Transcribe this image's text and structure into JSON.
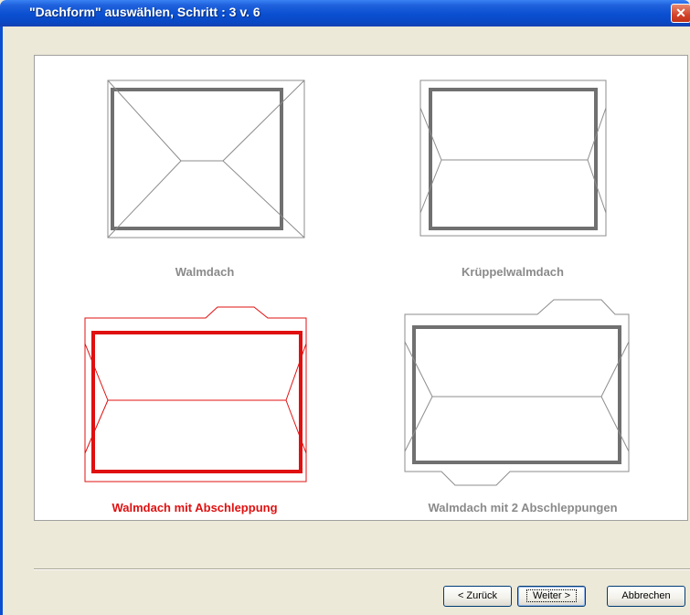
{
  "window": {
    "title": "\"Dachform\" auswählen, Schritt : 3 v. 6",
    "close_glyph": "✕"
  },
  "options": [
    {
      "label": "Walmdach",
      "selected": false
    },
    {
      "label": "Krüppelwalmdach",
      "selected": false
    },
    {
      "label": "Walmdach mit Abschleppung",
      "selected": true
    },
    {
      "label": "Walmdach mit 2 Abschleppungen",
      "selected": false
    }
  ],
  "buttons": {
    "back": "< Zurück",
    "next": "Weiter >",
    "cancel": "Abbrechen"
  },
  "colors": {
    "selected": "#e01010",
    "unselected_label": "#8a8a8a",
    "roof_outline": "#707070"
  }
}
